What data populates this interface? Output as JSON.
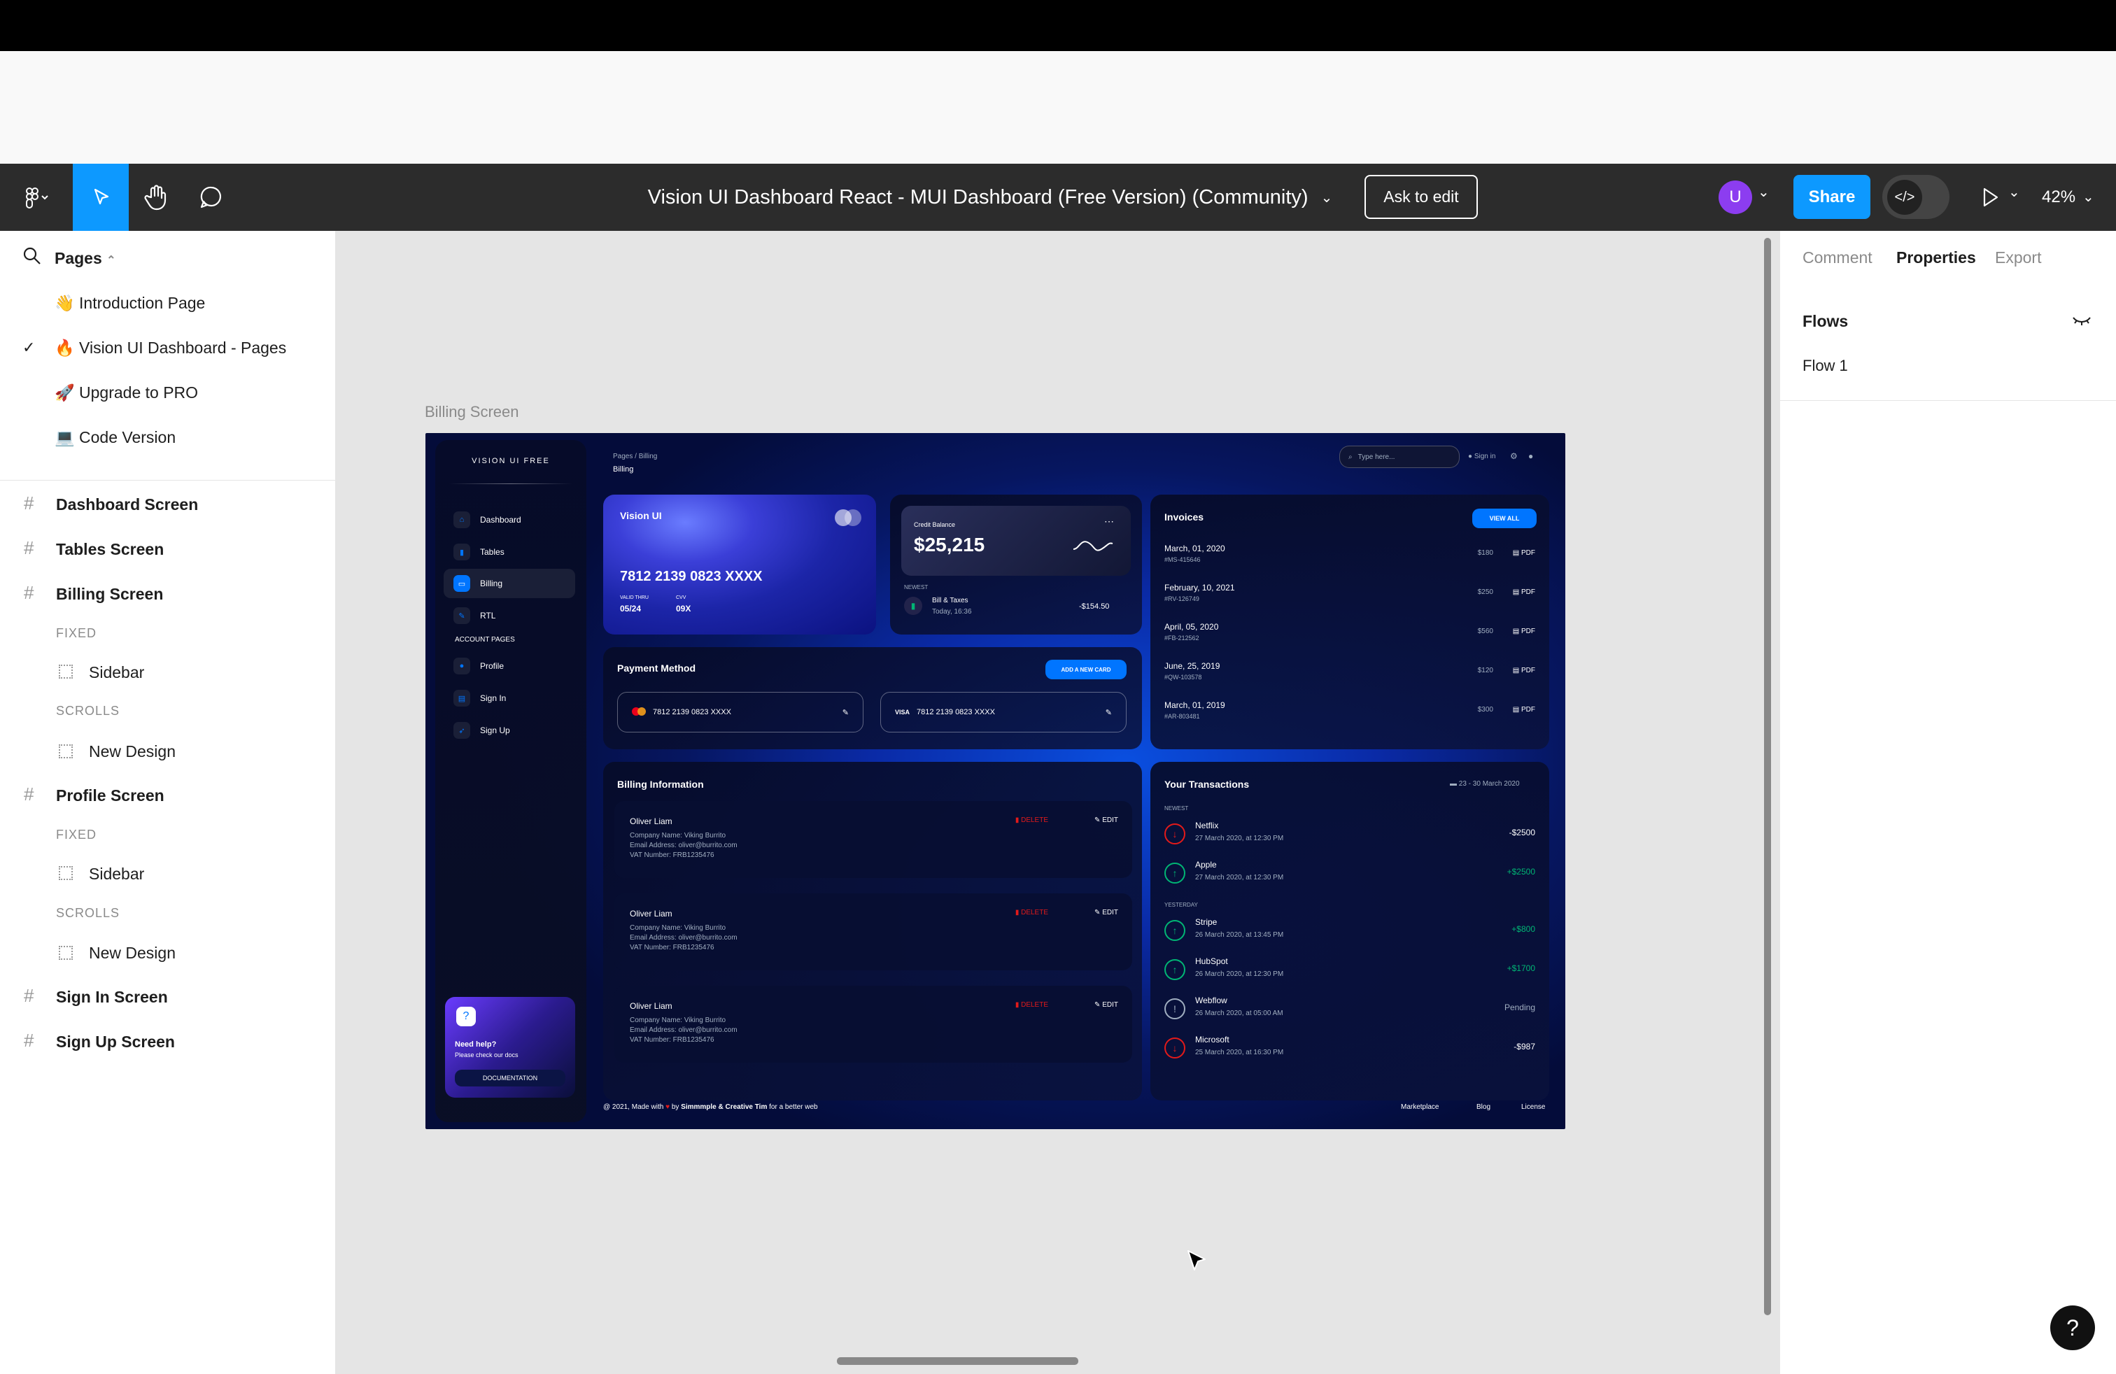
{
  "toolbar": {
    "file_title": "Vision UI Dashboard React - MUI Dashboard (Free Version) (Community)",
    "ask_to_edit": "Ask to edit",
    "avatar_initial": "U",
    "share": "Share",
    "zoom": "42%"
  },
  "left_panel": {
    "pages_label": "Pages",
    "pages": [
      {
        "emoji": "👋",
        "label": "Introduction Page"
      },
      {
        "emoji": "🔥",
        "label": "Vision UI Dashboard - Pages",
        "selected": true
      },
      {
        "emoji": "🚀",
        "label": "Upgrade to PRO"
      },
      {
        "emoji": "💻",
        "label": "Code Version"
      }
    ],
    "layers": {
      "dashboard": "Dashboard Screen",
      "tables": "Tables Screen",
      "billing": "Billing Screen",
      "billing_fixed": "FIXED",
      "billing_sidebar": "Sidebar",
      "billing_scrolls": "SCROLLS",
      "billing_newdesign": "New Design",
      "profile": "Profile Screen",
      "profile_fixed": "FIXED",
      "profile_sidebar": "Sidebar",
      "profile_scrolls": "SCROLLS",
      "profile_newdesign": "New Design",
      "signin": "Sign In Screen",
      "signup": "Sign Up Screen"
    }
  },
  "canvas": {
    "frame_label": "Billing Screen"
  },
  "right_panel": {
    "tabs": [
      "Comment",
      "Properties",
      "Export"
    ],
    "active_tab": "Properties",
    "flows_title": "Flows",
    "flow_item": "Flow 1"
  },
  "dashboard": {
    "brand": "VISION UI FREE",
    "breadcrumb": "Pages / Billing",
    "page_title": "Billing",
    "search_placeholder": "Type here...",
    "signin": "Sign in",
    "nav": [
      {
        "label": "Dashboard",
        "icon": "home-icon"
      },
      {
        "label": "Tables",
        "icon": "chart-icon"
      },
      {
        "label": "Billing",
        "icon": "card-icon",
        "active": true
      },
      {
        "label": "RTL",
        "icon": "wrench-icon"
      }
    ],
    "account_pages_label": "ACCOUNT PAGES",
    "account_nav": [
      {
        "label": "Profile",
        "icon": "user-icon"
      },
      {
        "label": "Sign In",
        "icon": "doc-icon"
      },
      {
        "label": "Sign Up",
        "icon": "rocket-icon"
      }
    ],
    "help": {
      "title": "Need help?",
      "subtitle": "Please check our docs",
      "button": "DOCUMENTATION"
    },
    "credit_card": {
      "brand": "Vision UI",
      "number": "7812 2139 0823 XXXX",
      "valid_label": "VALID THRU",
      "valid": "05/24",
      "cvv_label": "CVV",
      "cvv": "09X"
    },
    "balance": {
      "label": "Credit Balance",
      "amount": "$25,215",
      "newest": "NEWEST",
      "item": "Bill & Taxes",
      "item_date": "Today, 16:36",
      "item_amount": "-$154.50"
    },
    "invoices": {
      "title": "Invoices",
      "button": "VIEW ALL",
      "rows": [
        {
          "date": "March, 01, 2020",
          "id": "#MS-415646",
          "amount": "$180",
          "pdf": "PDF"
        },
        {
          "date": "February, 10, 2021",
          "id": "#RV-126749",
          "amount": "$250",
          "pdf": "PDF"
        },
        {
          "date": "April, 05, 2020",
          "id": "#FB-212562",
          "amount": "$560",
          "pdf": "PDF"
        },
        {
          "date": "June, 25, 2019",
          "id": "#QW-103578",
          "amount": "$120",
          "pdf": "PDF"
        },
        {
          "date": "March, 01, 2019",
          "id": "#AR-803481",
          "amount": "$300",
          "pdf": "PDF"
        }
      ]
    },
    "payment": {
      "title": "Payment Method",
      "button": "ADD A NEW CARD",
      "cards": [
        {
          "brand": "mastercard",
          "number": "7812 2139 0823 XXXX"
        },
        {
          "brand": "VISA",
          "number": "7812 2139 0823 XXXX"
        }
      ]
    },
    "billing_info": {
      "title": "Billing Information",
      "delete": "DELETE",
      "edit": "EDIT",
      "entries": [
        {
          "name": "Oliver Liam",
          "company": "Company Name: Viking Burrito",
          "email": "Email Address: oliver@burrito.com",
          "vat": "VAT Number: FRB1235476"
        },
        {
          "name": "Oliver Liam",
          "company": "Company Name: Viking Burrito",
          "email": "Email Address: oliver@burrito.com",
          "vat": "VAT Number: FRB1235476"
        },
        {
          "name": "Oliver Liam",
          "company": "Company Name: Viking Burrito",
          "email": "Email Address: oliver@burrito.com",
          "vat": "VAT Number: FRB1235476"
        }
      ]
    },
    "transactions": {
      "title": "Your Transactions",
      "range": "23 - 30 March 2020",
      "newest": "NEWEST",
      "yesterday": "YESTERDAY",
      "rows": [
        {
          "name": "Netflix",
          "date": "27 March 2020, at 12:30 PM",
          "amount": "-$2500",
          "kind": "neg"
        },
        {
          "name": "Apple",
          "date": "27 March 2020, at 12:30 PM",
          "amount": "+$2500",
          "kind": "pos"
        },
        {
          "name": "Stripe",
          "date": "26 March 2020, at 13:45 PM",
          "amount": "+$800",
          "kind": "pos"
        },
        {
          "name": "HubSpot",
          "date": "26 March 2020, at 12:30 PM",
          "amount": "+$1700",
          "kind": "pos"
        },
        {
          "name": "Webflow",
          "date": "26 March 2020, at 05:00 AM",
          "amount": "Pending",
          "kind": "pending"
        },
        {
          "name": "Microsoft",
          "date": "25 March 2020, at 16:30 PM",
          "amount": "-$987",
          "kind": "neg"
        }
      ]
    },
    "footer": {
      "text_prefix": "@ 2021, Made with",
      "text_by": "by",
      "authors": "Simmmple & Creative Tim",
      "text_suffix": "for a better web",
      "links": [
        "Marketplace",
        "Blog",
        "License"
      ]
    }
  },
  "colors": {
    "accent": "#0d99ff",
    "toolbar": "#2c2c2c",
    "dash_blue": "#0075ff",
    "positive": "#01b574",
    "negative": "#e31a1a"
  }
}
